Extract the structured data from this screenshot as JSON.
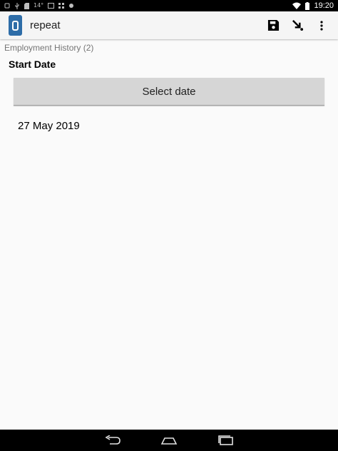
{
  "status_bar": {
    "time": "19:20",
    "indicator_temp": "14°"
  },
  "app_bar": {
    "title": "repeat",
    "icons": [
      "app-logo-icon",
      "save-icon",
      "go-to-arrow-icon",
      "overflow-menu-icon"
    ]
  },
  "form": {
    "group_label": "Employment History (2)",
    "question_label": "Start Date",
    "select_button_label": "Select date",
    "date_value": "27 May 2019"
  },
  "nav_bar": {
    "icons": [
      "back-icon",
      "home-icon",
      "recents-icon"
    ]
  }
}
